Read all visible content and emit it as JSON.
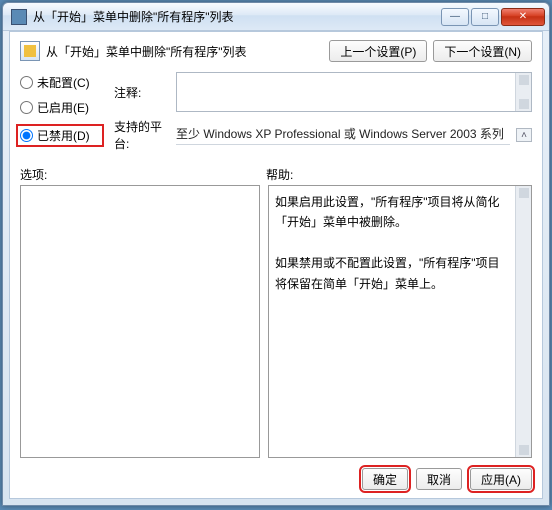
{
  "titlebar": {
    "text": "从「开始」菜单中删除\"所有程序\"列表"
  },
  "header": {
    "title": "从「开始」菜单中删除\"所有程序\"列表",
    "prev": "上一个设置(P)",
    "next": "下一个设置(N)"
  },
  "radios": {
    "not_configured": "未配置(C)",
    "enabled": "已启用(E)",
    "disabled": "已禁用(D)"
  },
  "labels": {
    "comment": "注释:",
    "platform": "支持的平台:",
    "options": "选项:",
    "help": "帮助:"
  },
  "platform_text": "至少 Windows XP Professional 或 Windows Server 2003 系列",
  "help_text": {
    "p1": "如果启用此设置，\"所有程序\"项目将从简化「开始」菜单中被删除。",
    "p2": "如果禁用或不配置此设置，\"所有程序\"项目将保留在简单「开始」菜单上。"
  },
  "buttons": {
    "ok": "确定",
    "cancel": "取消",
    "apply": "应用(A)"
  }
}
